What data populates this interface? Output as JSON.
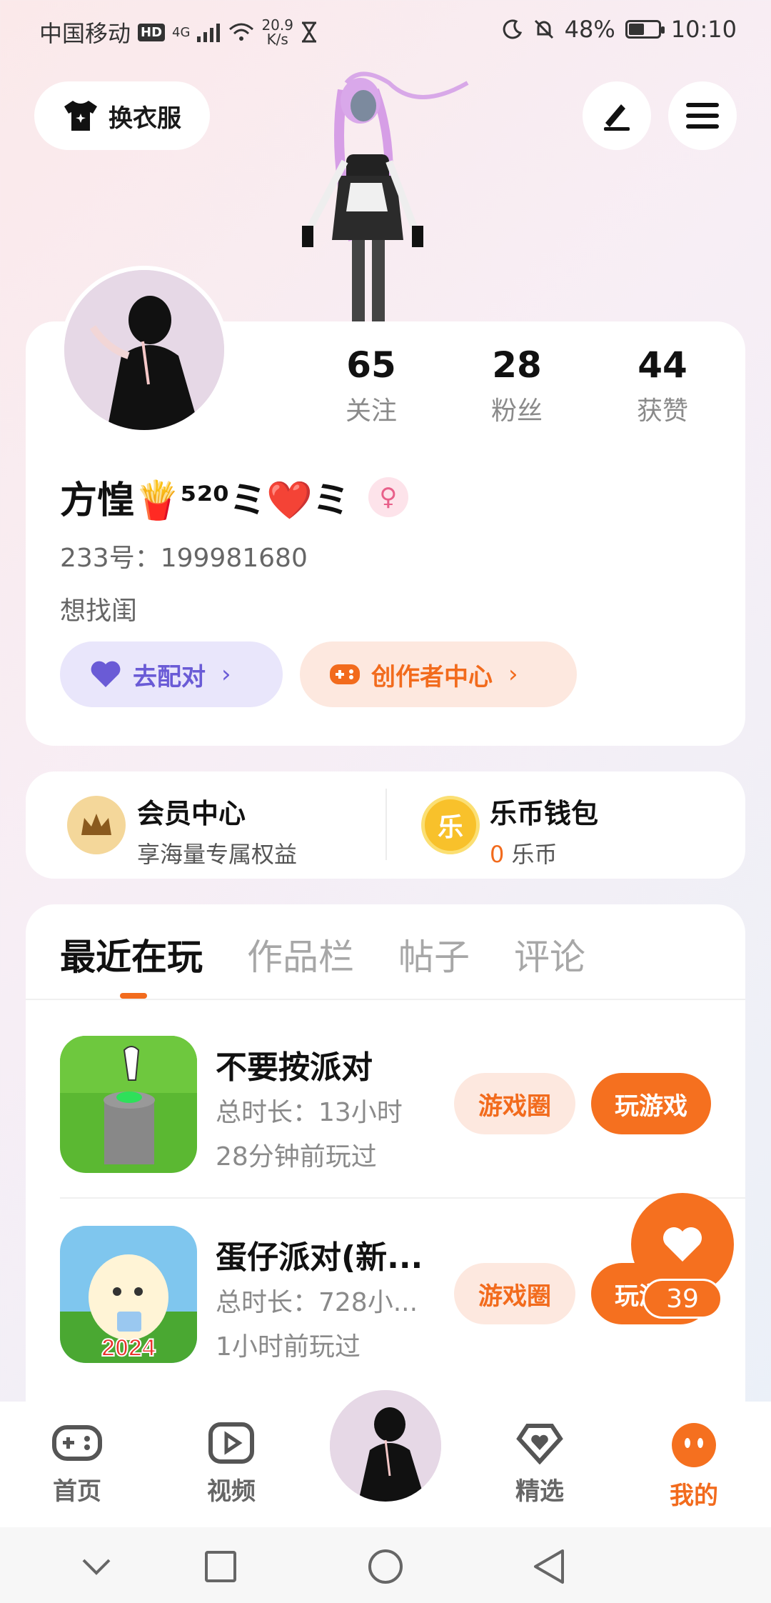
{
  "status_bar": {
    "carrier": "中国移动",
    "hd": "HD",
    "network": "4G",
    "speed_value": "20.9",
    "speed_unit": "K/s",
    "battery": "48%",
    "time": "10:10"
  },
  "top_actions": {
    "outfit_label": "换衣服",
    "edit_icon": "edit-icon",
    "menu_icon": "menu-icon"
  },
  "profile": {
    "stats": [
      {
        "value": "65",
        "label": "关注"
      },
      {
        "value": "28",
        "label": "粉丝"
      },
      {
        "value": "44",
        "label": "获赞"
      }
    ],
    "name": "方惶🍟⁵²⁰ミ❤️ミ",
    "gender_symbol": "♀",
    "uid": "233号：199981680",
    "bio": "想找闺",
    "match_label": "去配对",
    "creator_label": "创作者中心"
  },
  "member_wallet": {
    "member_title": "会员中心",
    "member_sub": "享海量专属权益",
    "wallet_title": "乐币钱包",
    "wallet_coin_glyph": "乐",
    "wallet_amount": "0",
    "wallet_unit": "乐币"
  },
  "tabs": [
    {
      "label": "最近在玩",
      "active": true
    },
    {
      "label": "作品栏",
      "active": false
    },
    {
      "label": "帖子",
      "active": false
    },
    {
      "label": "评论",
      "active": false
    }
  ],
  "games": [
    {
      "title": "不要按派对",
      "duration": "总时长：13小时",
      "last_played": "28分钟前玩过",
      "circle_label": "游戏圈",
      "play_label": "玩游戏"
    },
    {
      "title": "蛋仔派对(新...",
      "duration": "总时长：728小...",
      "last_played": "1小时前玩过",
      "circle_label": "游戏圈",
      "play_label": "玩游戏",
      "icon_badge": "2024"
    }
  ],
  "like": {
    "count": "39"
  },
  "bottom_nav": [
    {
      "label": "首页",
      "icon": "gamepad-icon",
      "active": false
    },
    {
      "label": "视频",
      "icon": "video-icon",
      "active": false
    },
    {
      "label": "精选",
      "icon": "heart-diamond-icon",
      "active": false
    },
    {
      "label": "我的",
      "icon": "face-icon",
      "active": true
    }
  ],
  "colors": {
    "accent": "#f26b1d",
    "match": "#6a5bd6"
  }
}
